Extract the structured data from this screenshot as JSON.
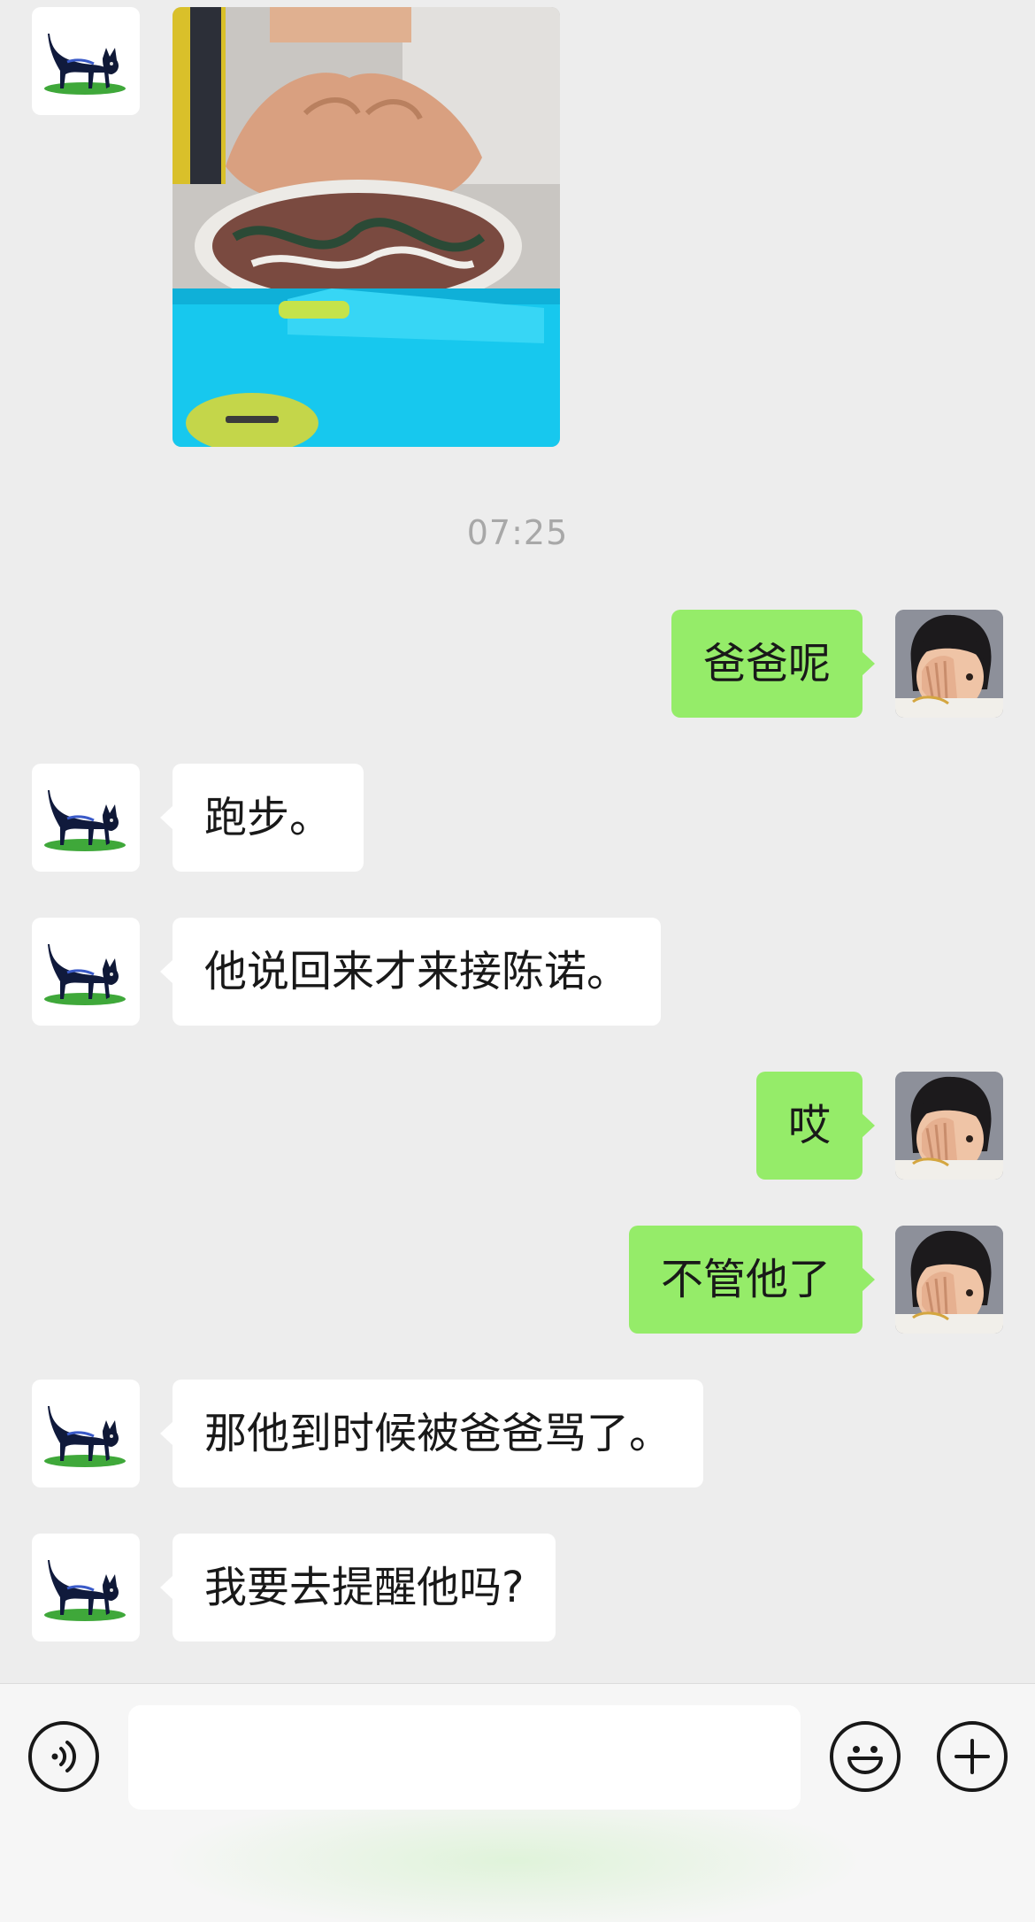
{
  "chat": {
    "timestamp": "07:25",
    "messages": [
      {
        "from": "me",
        "text": "爸爸呢"
      },
      {
        "from": "other",
        "text": "跑步。"
      },
      {
        "from": "other",
        "text": "他说回来才来接陈诺。"
      },
      {
        "from": "me",
        "text": "哎"
      },
      {
        "from": "me",
        "text": "不管他了"
      },
      {
        "from": "other",
        "text": "那他到时候被爸爸骂了。"
      },
      {
        "from": "other",
        "text": "我要去提醒他吗?"
      }
    ]
  },
  "avatars": {
    "other": "black-cat-icon",
    "me": "girl-photo"
  },
  "input": {
    "value": "",
    "placeholder": ""
  },
  "icons": {
    "voice": "voice-icon",
    "emoji": "emoji-icon",
    "more": "plus-icon"
  },
  "colors": {
    "background": "#ededed",
    "outgoing_bubble": "#95ec69",
    "incoming_bubble": "#ffffff",
    "timestamp": "#a8a8a8"
  }
}
